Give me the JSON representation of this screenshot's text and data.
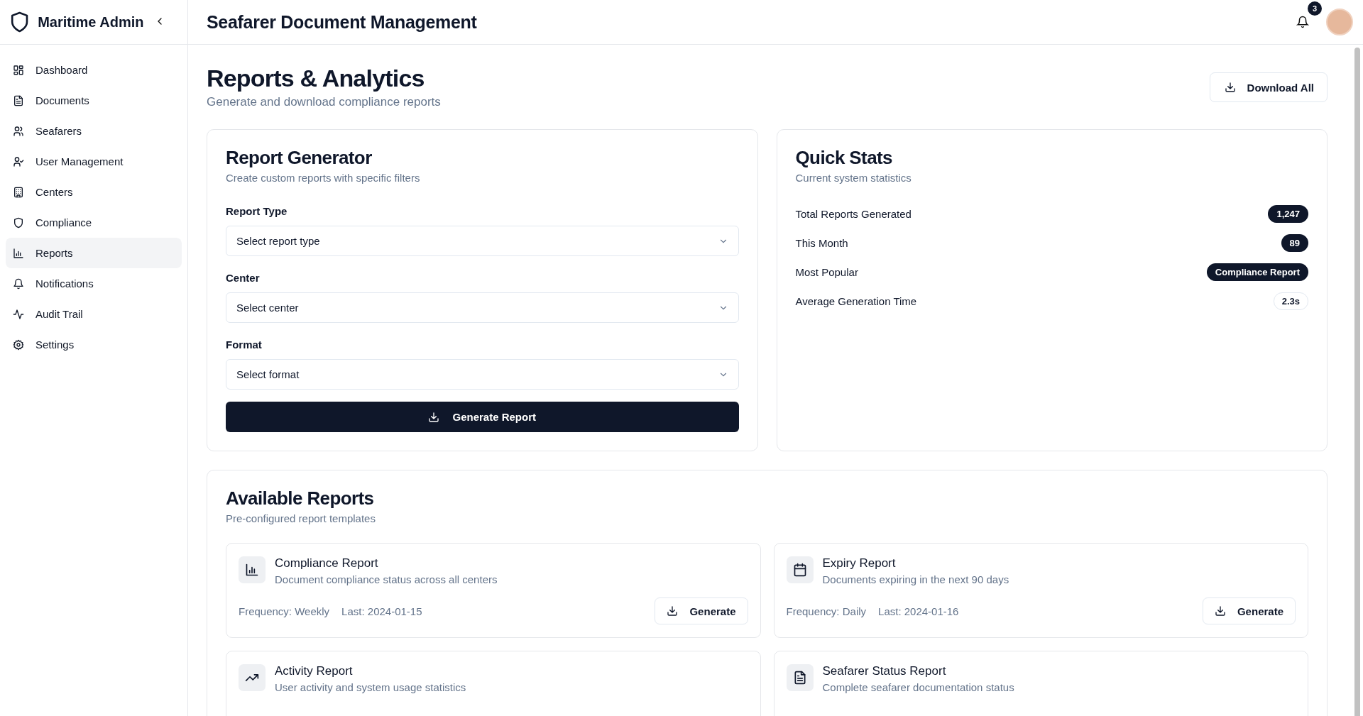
{
  "sidebar": {
    "title": "Maritime Admin",
    "items": [
      {
        "label": "Dashboard",
        "selected": false
      },
      {
        "label": "Documents",
        "selected": false
      },
      {
        "label": "Seafarers",
        "selected": false
      },
      {
        "label": "User Management",
        "selected": false
      },
      {
        "label": "Centers",
        "selected": false
      },
      {
        "label": "Compliance",
        "selected": false
      },
      {
        "label": "Reports",
        "selected": true
      },
      {
        "label": "Notifications",
        "selected": false
      },
      {
        "label": "Audit Trail",
        "selected": false
      },
      {
        "label": "Settings",
        "selected": false
      }
    ]
  },
  "header": {
    "title": "Seafarer Document Management",
    "notification_count": "3"
  },
  "page": {
    "title": "Reports & Analytics",
    "subtitle": "Generate and download compliance reports",
    "download_button": "Download All"
  },
  "report_generator": {
    "title": "Report Generator",
    "subtitle": "Create custom reports with specific filters",
    "fields": [
      {
        "label": "Report Type",
        "placeholder": "Select report type"
      },
      {
        "label": "Center",
        "placeholder": "Select center"
      },
      {
        "label": "Format",
        "placeholder": "Select format"
      }
    ],
    "button": "Generate Report"
  },
  "quick_stats": {
    "title": "Quick Stats",
    "subtitle": "Current system statistics",
    "rows": [
      {
        "label": "Total Reports Generated",
        "value": "1,247",
        "kind": "filled"
      },
      {
        "label": "This Month",
        "value": "89",
        "kind": "filled"
      },
      {
        "label": "Most Popular",
        "value": "Compliance Report",
        "kind": "filled"
      },
      {
        "label": "Average Generation Time",
        "value": "2.3s",
        "kind": "outline"
      }
    ]
  },
  "available_reports": {
    "title": "Available Reports",
    "subtitle": "Pre-configured report templates",
    "reports": [
      {
        "title": "Compliance Report",
        "description": "Document compliance status across all centers",
        "frequency": "Frequency: Weekly",
        "last": "Last: 2024-01-15",
        "button": "Generate"
      },
      {
        "title": "Expiry Report",
        "description": "Documents expiring in the next 90 days",
        "frequency": "Frequency: Daily",
        "last": "Last: 2024-01-16",
        "button": "Generate"
      },
      {
        "title": "Activity Report",
        "description": "User activity and system usage statistics"
      },
      {
        "title": "Seafarer Status Report",
        "description": "Complete seafarer documentation status"
      }
    ]
  }
}
